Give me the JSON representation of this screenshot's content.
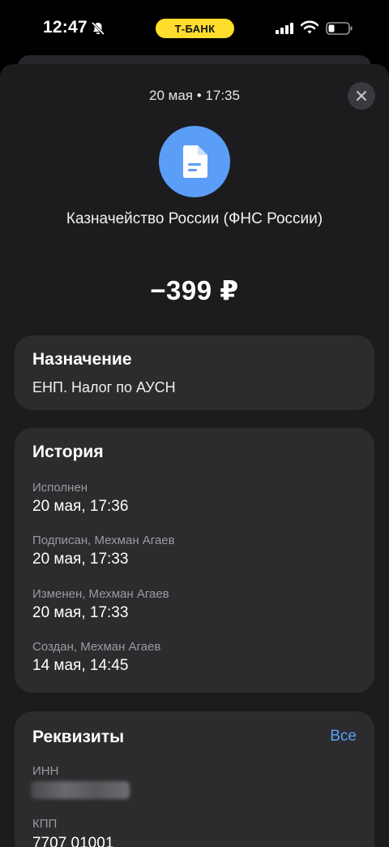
{
  "status_bar": {
    "time": "12:47",
    "bank_label": "Т-БАНК",
    "bank_color": "#ffdd2d"
  },
  "header": {
    "date": "20 мая • 17:35",
    "close_icon": "close-icon"
  },
  "operation": {
    "icon": "document-icon",
    "icon_bg": "#5b9ef7",
    "recipient": "Казначейство России (ФНС России)",
    "amount": "−399 ₽"
  },
  "purpose": {
    "title": "Назначение",
    "text": "ЕНП. Налог по АУСН"
  },
  "history": {
    "title": "История",
    "items": [
      {
        "label": "Исполнен",
        "value": "20 мая, 17:36"
      },
      {
        "label": "Подписан, Мехман Агаев",
        "value": "20 мая, 17:33"
      },
      {
        "label": "Изменен, Мехман Агаев",
        "value": "20 мая, 17:33"
      },
      {
        "label": "Создан, Мехман Агаев",
        "value": "14 мая, 14:45"
      }
    ]
  },
  "requisites": {
    "title": "Реквизиты",
    "all_label": "Все",
    "inn_label": "ИНН",
    "kpp_label": "КПП",
    "kpp_value": "7707 01001"
  }
}
